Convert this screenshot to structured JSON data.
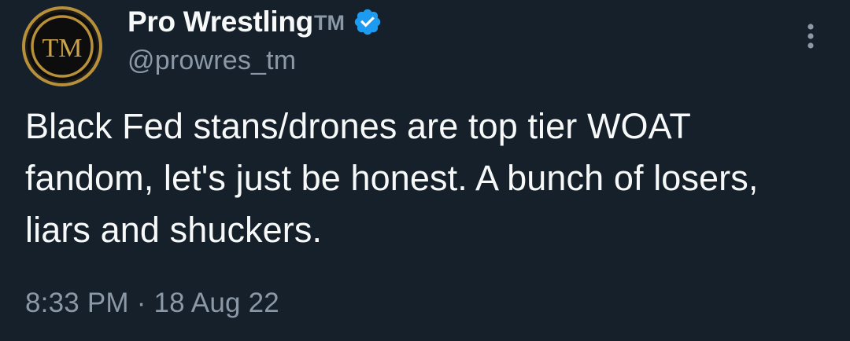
{
  "author": {
    "display_name": "Pro Wrestling",
    "name_suffix": "TM",
    "handle": "@prowres_tm",
    "avatar_text": "TM",
    "verified": true,
    "verified_color": "#1d9bf0"
  },
  "tweet": {
    "text": "Black Fed stans/drones are top tier WOAT fandom, let's just be honest. A bunch of losers, liars and shuckers.",
    "time": "8:33 PM",
    "separator": "·",
    "date": "18 Aug 22"
  },
  "icons": {
    "verified": "verified-badge-icon",
    "more": "more-options-icon"
  },
  "colors": {
    "background": "#15202b",
    "primary_text": "#f7f9f9",
    "secondary_text": "#8b98a5",
    "avatar_gold": "#b8903a"
  }
}
